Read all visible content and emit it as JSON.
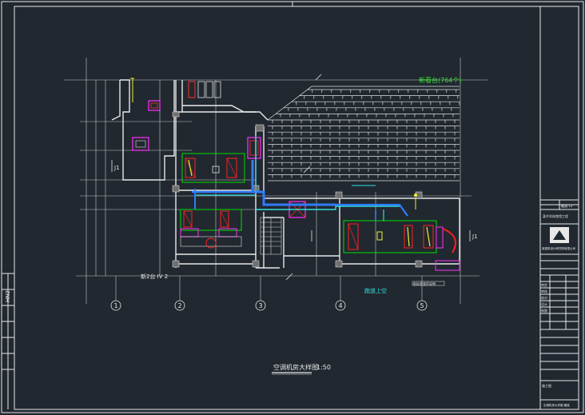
{
  "drawing": {
    "title": "空调机房大样图",
    "scale": "1:50",
    "bleachers_label": "新看台(764个)",
    "room_label_left": "新2台 IV 2",
    "podium_label": "跑道上空",
    "lower_label": "新标准规范说明",
    "detail_mark": "1",
    "axis_labels": [
      "1",
      "2",
      "3",
      "4",
      "5"
    ],
    "annotation_left": "J1",
    "annotation_right": "J1",
    "left_code": "HN2",
    "sheet_stamp": "1.42"
  },
  "title_block": {
    "project": "某中学体育馆工程",
    "drawing_no": "暖施-12",
    "design_unit": "某建筑设计研究院有限公司",
    "approval_rows": [
      "审定",
      "审核",
      "校对",
      "设计",
      "制图"
    ],
    "bottom_label": "施工图",
    "footer": "空调机房大样图 暖施"
  },
  "colors": {
    "background": "#212830",
    "wall": "#e0e0e0",
    "equipment": "#00e000",
    "duct_blue": "#2f7cff",
    "cyan": "#30e0e0",
    "magenta": "#ff30ff",
    "red": "#ff2020",
    "yellow": "#f0f030"
  }
}
